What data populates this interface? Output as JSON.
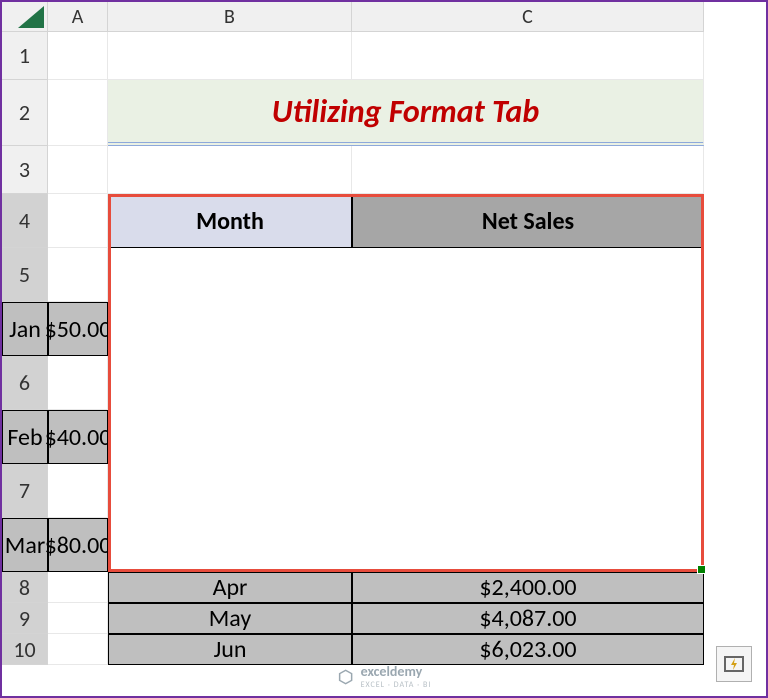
{
  "columns": [
    "A",
    "B",
    "C"
  ],
  "rows": [
    "1",
    "2",
    "3",
    "4",
    "5",
    "6",
    "7",
    "8",
    "9",
    "10"
  ],
  "title": "Utilizing Format Tab",
  "headers": {
    "month": "Month",
    "sales": "Net Sales"
  },
  "data": [
    {
      "month": "Jan",
      "sales": "$50.00"
    },
    {
      "month": "Feb",
      "sales": "$40.00"
    },
    {
      "month": "Mar",
      "sales": "$80.00"
    },
    {
      "month": "Apr",
      "sales": "$2,400.00"
    },
    {
      "month": "May",
      "sales": "$4,087.00"
    },
    {
      "month": "Jun",
      "sales": "$6,023.00"
    }
  ],
  "watermark": {
    "brand": "exceldemy",
    "tagline": "EXCEL · DATA · BI"
  },
  "chart_data": {
    "type": "table",
    "title": "Utilizing Format Tab",
    "columns": [
      "Month",
      "Net Sales"
    ],
    "rows": [
      [
        "Jan",
        50.0
      ],
      [
        "Feb",
        40.0
      ],
      [
        "Mar",
        80.0
      ],
      [
        "Apr",
        2400.0
      ],
      [
        "May",
        4087.0
      ],
      [
        "Jun",
        6023.0
      ]
    ]
  }
}
